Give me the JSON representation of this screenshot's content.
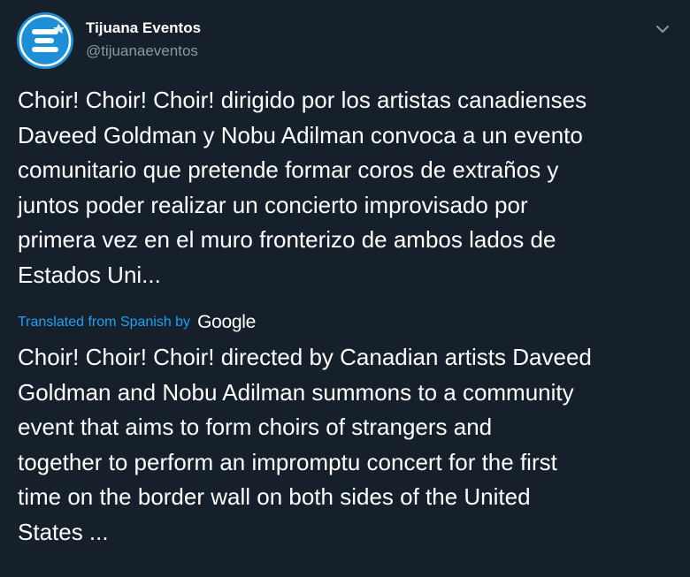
{
  "account": {
    "display_name": "Tijuana Eventos",
    "handle": "@tijuanaeventos",
    "avatar_icon": "tijuana-eventos-logo-icon",
    "avatar_color": "#1d8fd6"
  },
  "menu": {
    "caret_icon": "chevron-down-icon"
  },
  "tweet": {
    "text": "Choir! Choir! Choir! dirigido por los artistas canadienses\nDaveed Goldman y Nobu Adilman convoca a un evento\ncomunitario que pretende formar coros de extraños y\njuntos poder realizar un concierto improvisado por\nprimera vez en el muro fronterizo de ambos lados de\nEstados Uni..."
  },
  "translation": {
    "label": "Translated from Spanish by",
    "provider": "Google",
    "text": "Choir! Choir! Choir! directed by Canadian artists Daveed\nGoldman and Nobu Adilman summons to a community\nevent that aims to form choirs of strangers and\ntogether to perform an impromptu concert for the first\ntime on the border wall on both sides of the United\nStates ..."
  },
  "colors": {
    "background": "#15202b",
    "text_primary": "#ffffff",
    "text_secondary": "#8899a6",
    "link": "#1da1f2"
  }
}
